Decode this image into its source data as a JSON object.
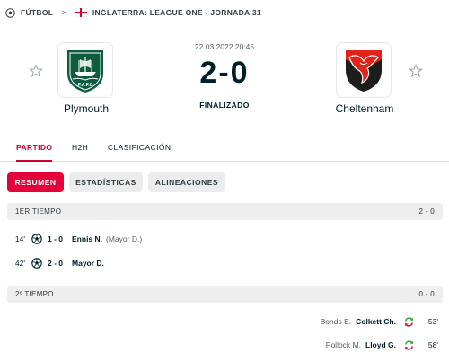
{
  "breadcrumb": {
    "sport": "FÚTBOL",
    "separator": ">",
    "competition": "INGLATERRA: LEAGUE ONE - JORNADA 31",
    "sport_icon": "soccer-ball-icon",
    "flag_icon": "england-flag-icon"
  },
  "match": {
    "date": "22.03.2022 20:45",
    "score": "2-0",
    "status": "FINALIZADO",
    "home": {
      "name": "Plymouth",
      "logo_icon": "plymouth-crest-icon"
    },
    "away": {
      "name": "Cheltenham",
      "logo_icon": "cheltenham-crest-icon"
    }
  },
  "tabs": [
    {
      "label": "PARTIDO",
      "active": true
    },
    {
      "label": "H2H",
      "active": false
    },
    {
      "label": "CLASIFICACIÓN",
      "active": false
    }
  ],
  "subtabs": [
    {
      "label": "RESUMEN",
      "active": true
    },
    {
      "label": "ESTADÍSTICAS",
      "active": false
    },
    {
      "label": "ALINEACIONES",
      "active": false
    }
  ],
  "periods": [
    {
      "label": "1ER TIEMPO",
      "score": "2 - 0",
      "events": [
        {
          "minute": "14'",
          "score": "1 - 0",
          "player": "Ennis N.",
          "assist": "(Mayor D.)",
          "icon": "goal-ball-icon"
        },
        {
          "minute": "42'",
          "score": "2 - 0",
          "player": "Mayor D.",
          "assist": "",
          "icon": "goal-ball-icon"
        }
      ]
    },
    {
      "label": "2º TIEMPO",
      "score": "0 - 0",
      "events": [
        {
          "minute": "53'",
          "player_out": "Bonds E.",
          "player_in": "Colkett Ch.",
          "icon": "substitution-icon"
        },
        {
          "minute": "58'",
          "player_out": "Pollock M.",
          "player_in": "Lloyd G.",
          "icon": "substitution-icon"
        }
      ]
    }
  ],
  "colors": {
    "accent": "#e4003a",
    "text": "#001e28",
    "period_bg": "#eeeeee",
    "sub_in": "#2aa32a",
    "sub_out": "#e4003a"
  }
}
